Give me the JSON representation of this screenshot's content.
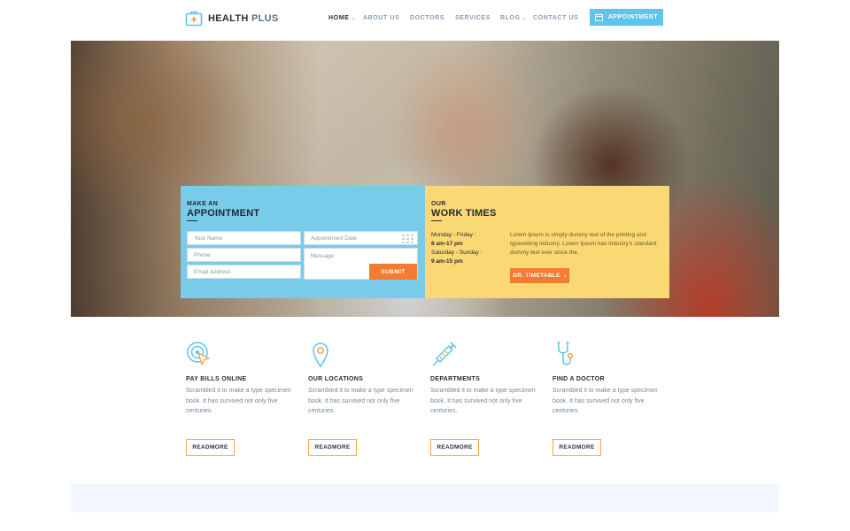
{
  "brand": {
    "name_main": "HEALTH",
    "name_accent": "PLUS",
    "icon": "medical-kit-icon",
    "accent_color": "#5bc5ea"
  },
  "nav": {
    "items": [
      {
        "label": "HOME",
        "dropdown": true,
        "active": true
      },
      {
        "label": "ABOUT US",
        "dropdown": false
      },
      {
        "label": "DOCTORS",
        "dropdown": false
      },
      {
        "label": "SERVICES",
        "dropdown": false
      },
      {
        "label": "BLOG",
        "dropdown": true
      },
      {
        "label": "CONTACT US",
        "dropdown": false
      }
    ],
    "cta_label": "APPOINTMENT",
    "cta_icon": "calendar-icon"
  },
  "appointment": {
    "kicker": "MAKE AN",
    "title": "APPOINTMENT",
    "name_placeholder": "Your Name",
    "date_placeholder": "Appointment Date",
    "phone_placeholder": "Phone",
    "message_placeholder": "Message",
    "email_placeholder": "Email Address",
    "submit_label": "SUBMIT",
    "panel_color": "#79cbea",
    "button_color": "#f47b2f"
  },
  "work_times": {
    "kicker": "OUR",
    "title": "WORK TIMES",
    "weekday_label": "Monday - Friday :",
    "weekday_hours": "8 am-17 pm",
    "weekend_label": "Saturday - Sunday :",
    "weekend_hours": "9 am-15 pm",
    "description": "Lorem Ipsum is simply dummy text of the printing and typesetting industry. Lorem Ipsum has industry's standard dummy text ever since the.",
    "button_label": "DR. TIMETABLE",
    "panel_color": "#fad874"
  },
  "features": [
    {
      "icon": "target-cursor-icon",
      "title": "PAY BILLS ONLINE",
      "text": "Scrambled it to make a type specimen book. It has survived not only five centuries.",
      "button": "READMORE"
    },
    {
      "icon": "map-pin-icon",
      "title": "OUR LOCATIONS",
      "text": "Scrambled it to make a type specimen book. It has survived not only five centuries.",
      "button": "READMORE"
    },
    {
      "icon": "syringe-icon",
      "title": "DEPARTMENTS",
      "text": "Scrambled it to make a type specimen book. It has survived not only five centuries.",
      "button": "READMORE"
    },
    {
      "icon": "stethoscope-icon",
      "title": "FIND A DOCTOR",
      "text": "Scrambled it to make a type specimen book. It has survived not only five centuries.",
      "button": "READMORE"
    }
  ]
}
